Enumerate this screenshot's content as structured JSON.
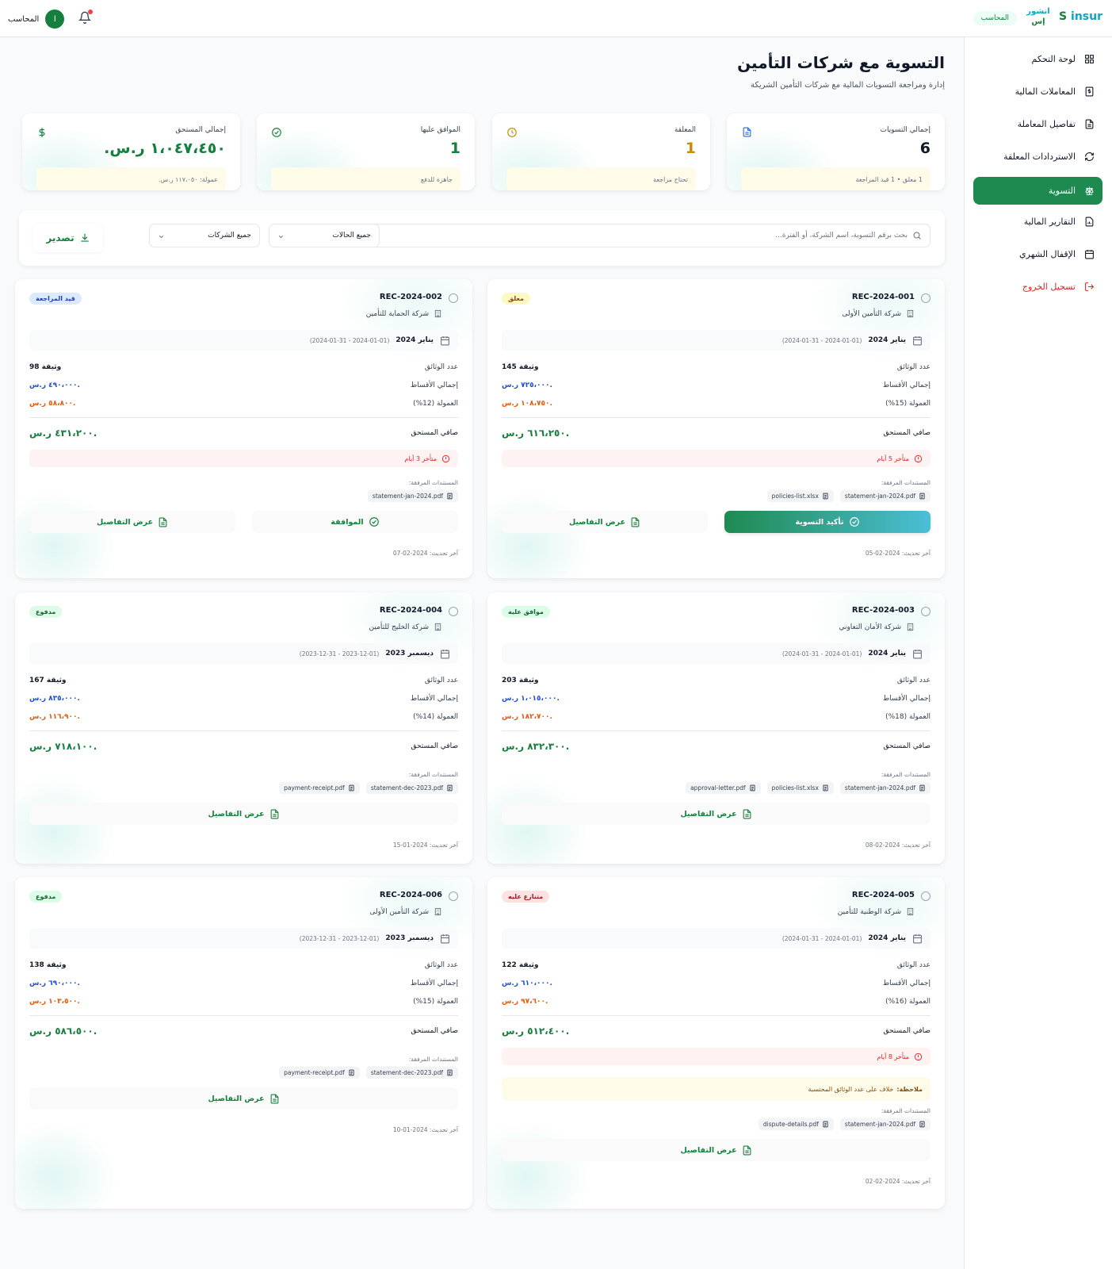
{
  "app": {
    "logo_latin_prefix": "S",
    "logo_latin": "insur",
    "logo_ar_1": "انشور",
    "logo_ar_2": "إس",
    "role_pill": "المحاسب"
  },
  "user": {
    "name": "المحاسب",
    "initial": "ا"
  },
  "sidebar": {
    "items": [
      {
        "label": "لوحة التحكم",
        "icon": "grid-icon"
      },
      {
        "label": "المعاملات المالية",
        "icon": "dollar-doc-icon"
      },
      {
        "label": "تفاصيل المعاملة",
        "icon": "document-icon"
      },
      {
        "label": "الاستردادات المعلقة",
        "icon": "refresh-icon"
      },
      {
        "label": "التسوية",
        "icon": "scale-icon",
        "active": true
      },
      {
        "label": "التقارير المالية",
        "icon": "report-icon"
      },
      {
        "label": "الإقفال الشهري",
        "icon": "calendar-icon"
      },
      {
        "label": "تسجيل الخروج",
        "icon": "logout-icon"
      }
    ]
  },
  "page": {
    "title": "التسوية مع شركات التأمين",
    "subtitle": "إدارة ومراجعة التسويات المالية مع شركات التأمين الشريكة"
  },
  "stats": [
    {
      "label": "إجمالي التسويات",
      "value": "6",
      "note": "1 معلق • 1 قيد المراجعة",
      "icon": "document-icon",
      "color": "#111827"
    },
    {
      "label": "المعلقة",
      "value": "1",
      "note": "تحتاج مراجعة",
      "icon": "clock-icon",
      "color": "#ca8a04"
    },
    {
      "label": "الموافق عليها",
      "value": "1",
      "note": "جاهزة للدفع",
      "icon": "check-circle-icon",
      "color": "#15803d"
    },
    {
      "label": "إجمالي المستحق",
      "value": "١،٠٤٧،٤٥٠ ر.س.",
      "note": "عمولة: ١١٧،٠٥٠ ر.س.",
      "icon": "dollar-icon",
      "color": "#15803d"
    }
  ],
  "filters": {
    "search_placeholder": "بحث برقم التسوية، اسم الشركة، أو الفترة...",
    "status": "جميع الحالات",
    "company": "جميع الشركات",
    "export": "تصدير"
  },
  "labels": {
    "policies": "عدد الوثائق",
    "premiums": "إجمالي الأقساط",
    "net": "صافي المستحق",
    "attachments": "المستندات المرفقة:",
    "updated": "آخر تحديث:",
    "view": "عرض التفاصيل",
    "confirm": "تأكيد التسوية",
    "approve": "الموافقة",
    "note_prefix": "ملاحظة:"
  },
  "cards": [
    {
      "id": "REC-2024-001",
      "company": "شركة التأمين الأولى",
      "status": "معلق",
      "status_bg": "#fef9c3",
      "status_fg": "#854d0e",
      "period": "يناير 2024",
      "range": "(2024-01-01 - 2024-01-31)",
      "policies": "145 وثيقة",
      "premiums": "٧٢٥،٠٠٠ ر.س.",
      "commission_label": "العمولة (15%)",
      "commission": "١٠٨،٧٥٠ ر.س.",
      "net": "٦١٦،٢٥٠ ر.س.",
      "late": "متأخر 5 أيام",
      "note": "",
      "files": [
        "statement-jan-2024.pdf",
        "policies-list.xlsx"
      ],
      "updated": "2024-02-05"
    },
    {
      "id": "REC-2024-002",
      "company": "شركة الحماية للتأمين",
      "status": "قيد المراجعة",
      "status_bg": "#dbeafe",
      "status_fg": "#1e40af",
      "period": "يناير 2024",
      "range": "(2024-01-01 - 2024-01-31)",
      "policies": "98 وثيقة",
      "premiums": "٤٩٠،٠٠٠ ر.س.",
      "commission_label": "العمولة (12%)",
      "commission": "٥٨،٨٠٠ ر.س.",
      "net": "٤٣١،٢٠٠ ر.س.",
      "late": "متأخر 3 أيام",
      "note": "",
      "files": [
        "statement-jan-2024.pdf"
      ],
      "updated": "2024-02-07"
    },
    {
      "id": "REC-2024-003",
      "company": "شركة الأمان التعاوني",
      "status": "موافق عليه",
      "status_bg": "#dcfce7",
      "status_fg": "#166534",
      "period": "يناير 2024",
      "range": "(2024-01-01 - 2024-01-31)",
      "policies": "203 وثيقة",
      "premiums": "١،٠١٥،٠٠٠ ر.س.",
      "commission_label": "العمولة (18%)",
      "commission": "١٨٢،٧٠٠ ر.س.",
      "net": "٨٣٢،٣٠٠ ر.س.",
      "late": "",
      "note": "",
      "files": [
        "statement-jan-2024.pdf",
        "policies-list.xlsx",
        "approval-letter.pdf"
      ],
      "updated": "2024-02-08"
    },
    {
      "id": "REC-2024-004",
      "company": "شركة الخليج للتأمين",
      "status": "مدفوع",
      "status_bg": "#dcfce7",
      "status_fg": "#166534",
      "period": "ديسمبر 2023",
      "range": "(2023-12-01 - 2023-12-31)",
      "policies": "167 وثيقة",
      "premiums": "٨٣٥،٠٠٠ ر.س.",
      "commission_label": "العمولة (14%)",
      "commission": "١١٦،٩٠٠ ر.س.",
      "net": "٧١٨،١٠٠ ر.س.",
      "late": "",
      "note": "",
      "files": [
        "statement-dec-2023.pdf",
        "payment-receipt.pdf"
      ],
      "updated": "2024-01-15"
    },
    {
      "id": "REC-2024-005",
      "company": "شركة الوطنية للتأمين",
      "status": "متنازع عليه",
      "status_bg": "#fee2e2",
      "status_fg": "#991b1b",
      "period": "يناير 2024",
      "range": "(2024-01-01 - 2024-01-31)",
      "policies": "122 وثيقة",
      "premiums": "٦١٠،٠٠٠ ر.س.",
      "commission_label": "العمولة (16%)",
      "commission": "٩٧،٦٠٠ ر.س.",
      "net": "٥١٢،٤٠٠ ر.س.",
      "late": "متأخر 8 أيام",
      "note": "خلاف على عدد الوثائق المحتسبة",
      "files": [
        "statement-jan-2024.pdf",
        "dispute-details.pdf"
      ],
      "updated": "2024-02-02"
    },
    {
      "id": "REC-2024-006",
      "company": "شركة التأمين الأولى",
      "status": "مدفوع",
      "status_bg": "#dcfce7",
      "status_fg": "#166534",
      "period": "ديسمبر 2023",
      "range": "(2023-12-01 - 2023-12-31)",
      "policies": "138 وثيقة",
      "premiums": "٦٩٠،٠٠٠ ر.س.",
      "commission_label": "العمولة (15%)",
      "commission": "١٠٣،٥٠٠ ر.س.",
      "net": "٥٨٦،٥٠٠ ر.س.",
      "late": "",
      "note": "",
      "files": [
        "statement-dec-2023.pdf",
        "payment-receipt.pdf"
      ],
      "updated": "2024-01-10"
    }
  ]
}
